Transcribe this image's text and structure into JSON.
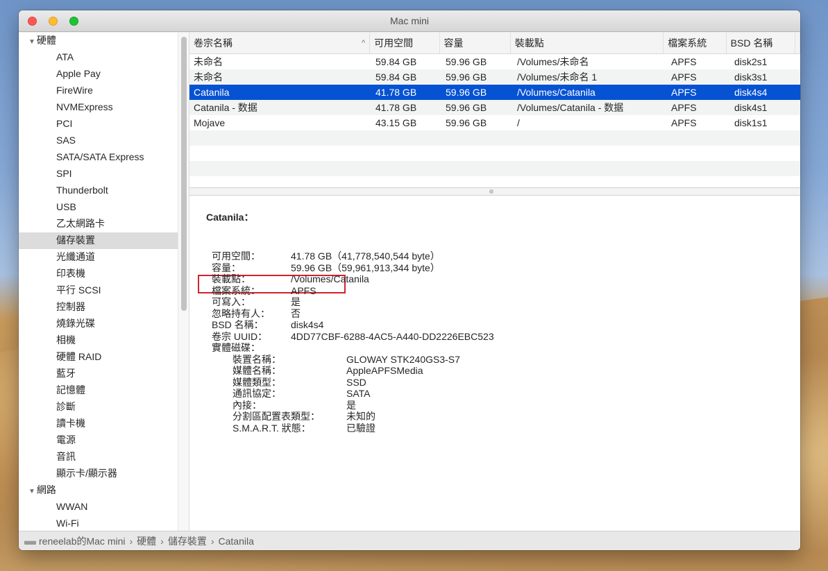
{
  "window": {
    "title": "Mac mini"
  },
  "sidebar": {
    "groups": [
      {
        "label": "硬體",
        "items": [
          {
            "label": "ATA"
          },
          {
            "label": "Apple Pay"
          },
          {
            "label": "FireWire"
          },
          {
            "label": "NVMExpress"
          },
          {
            "label": "PCI"
          },
          {
            "label": "SAS"
          },
          {
            "label": "SATA/SATA Express"
          },
          {
            "label": "SPI"
          },
          {
            "label": "Thunderbolt"
          },
          {
            "label": "USB"
          },
          {
            "label": "乙太網路卡"
          },
          {
            "label": "儲存裝置",
            "selected": true
          },
          {
            "label": "光纖通道"
          },
          {
            "label": "印表機"
          },
          {
            "label": "平行 SCSI"
          },
          {
            "label": "控制器"
          },
          {
            "label": "燒錄光碟"
          },
          {
            "label": "相機"
          },
          {
            "label": "硬體 RAID"
          },
          {
            "label": "藍牙"
          },
          {
            "label": "記憶體"
          },
          {
            "label": "診斷"
          },
          {
            "label": "讀卡機"
          },
          {
            "label": "電源"
          },
          {
            "label": "音訊"
          },
          {
            "label": "顯示卡/顯示器"
          }
        ]
      },
      {
        "label": "網路",
        "items": [
          {
            "label": "WWAN"
          },
          {
            "label": "Wi-Fi"
          }
        ]
      }
    ]
  },
  "table": {
    "columns": [
      "卷宗名稱",
      "可用空間",
      "容量",
      "裝載點",
      "檔案系統",
      "BSD 名稱"
    ],
    "sort_indicator": "^",
    "rows": [
      {
        "name": "未命名",
        "free": "59.84 GB",
        "capacity": "59.96 GB",
        "mount": "/Volumes/未命名",
        "fs": "APFS",
        "bsd": "disk2s1"
      },
      {
        "name": "未命名",
        "free": "59.84 GB",
        "capacity": "59.96 GB",
        "mount": "/Volumes/未命名 1",
        "fs": "APFS",
        "bsd": "disk3s1"
      },
      {
        "name": "Catanila",
        "free": "41.78 GB",
        "capacity": "59.96 GB",
        "mount": "/Volumes/Catanila",
        "fs": "APFS",
        "bsd": "disk4s4",
        "selected": true
      },
      {
        "name": "Catanila - 数据",
        "free": "41.78 GB",
        "capacity": "59.96 GB",
        "mount": "/Volumes/Catanila - 数据",
        "fs": "APFS",
        "bsd": "disk4s1"
      },
      {
        "name": "Mojave",
        "free": "43.15 GB",
        "capacity": "59.96 GB",
        "mount": "/",
        "fs": "APFS",
        "bsd": "disk1s1"
      }
    ]
  },
  "detail": {
    "title": "Catanila：",
    "fields": [
      {
        "key": "可用空間：",
        "value": "41.78 GB（41,778,540,544 byte）"
      },
      {
        "key": "容量：",
        "value": "59.96 GB（59,961,913,344 byte）"
      },
      {
        "key": "裝載點：",
        "value": "/Volumes/Catanila"
      },
      {
        "key": "檔案系統：",
        "value": "APFS"
      },
      {
        "key": "可寫入：",
        "value": "是"
      },
      {
        "key": "忽略持有人：",
        "value": "否"
      },
      {
        "key": "BSD 名稱：",
        "value": "disk4s4"
      },
      {
        "key": "卷宗 UUID：",
        "value": "4DD77CBF-6288-4AC5-A440-DD2226EBC523"
      },
      {
        "key": "實體磁碟：",
        "value": ""
      }
    ],
    "physical_disk": [
      {
        "key": "裝置名稱：",
        "value": "GLOWAY STK240GS3-S7"
      },
      {
        "key": "媒體名稱：",
        "value": "AppleAPFSMedia"
      },
      {
        "key": "媒體類型：",
        "value": "SSD"
      },
      {
        "key": "通訊協定：",
        "value": "SATA"
      },
      {
        "key": "內接：",
        "value": "是"
      },
      {
        "key": "分割區配置表類型：",
        "value": "未知的"
      },
      {
        "key": "S.M.A.R.T. 狀態：",
        "value": "已驗證"
      }
    ],
    "highlighted_field": "檔案系統："
  },
  "statusbar": {
    "crumbs": [
      "reneelab的Mac mini",
      "硬體",
      "儲存裝置",
      "Catanila"
    ],
    "separator": "›"
  },
  "colors": {
    "selection": "#0552d3",
    "highlight_box": "#d2232a"
  }
}
